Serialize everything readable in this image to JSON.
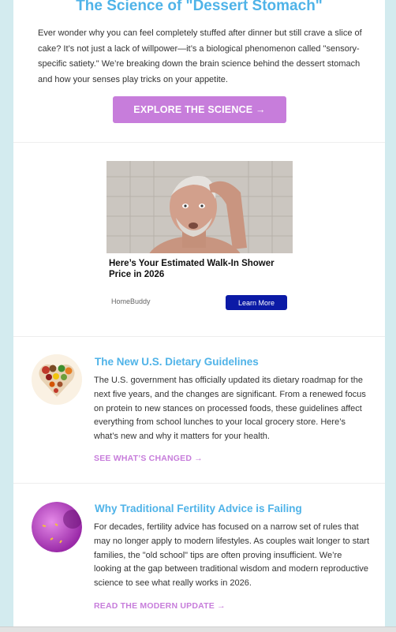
{
  "hero": {
    "title": "The Science of \"Dessert Stomach\"",
    "text": "Ever wonder why you can feel completely stuffed after dinner but still crave a slice of cake? It’s not just a lack of willpower—it’s a biological phenomenon called \"sensory-specific satiety.\" We’re breaking down the brain science behind the dessert stomach and how your senses play tricks on your appetite.",
    "button": "EXPLORE THE SCIENCE →"
  },
  "ad": {
    "headline": "Here’s Your Estimated Walk-In Shower Price in 2026",
    "source": "HomeBuddy",
    "cta": "Learn More"
  },
  "articles": [
    {
      "title": "The New U.S. Dietary Guidelines",
      "text": "The U.S. government has officially updated its dietary roadmap for the next five years, and the changes are significant. From a renewed focus on protein to new stances on processed foods, these guidelines affect everything from school lunches to your local grocery store. Here’s what’s new and why it matters for your health.",
      "link": "SEE WHAT’S CHANGED →"
    },
    {
      "title": "Why Traditional Fertility Advice is Failing",
      "text": "For decades, fertility advice has focused on a narrow set of rules that may no longer apply to modern lifestyles. As couples wait longer to start families, the \"old school\" tips are often proving insufficient. We’re looking at the gap between traditional wisdom and modern reproductive science to see what really works in 2026.",
      "link": "READ THE MODERN UPDATE →"
    }
  ],
  "colors": {
    "accent_blue": "#4fb3e8",
    "accent_purple": "#c77ddb",
    "ad_button": "#0b1aa6",
    "page_bg": "#d3ebef"
  }
}
